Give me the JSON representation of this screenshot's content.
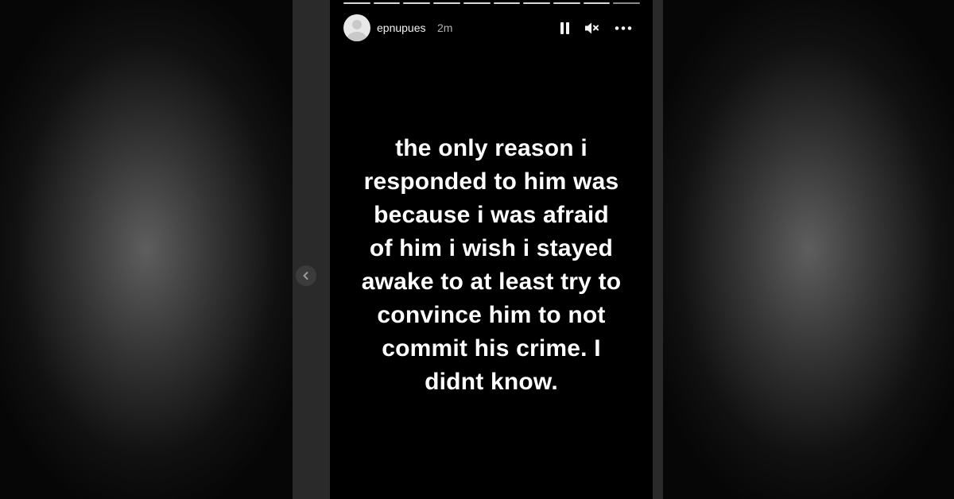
{
  "story": {
    "username": "epnupues",
    "timestamp": "2m",
    "progress_segments": 10,
    "text_lines": [
      "the only reason i",
      "responded to him was",
      "because i was afraid",
      "of him i wish i stayed",
      "awake to at least try to",
      "convince him to not",
      "commit his crime. I",
      "didnt know."
    ]
  },
  "controls": {
    "pause_icon": "pause-icon",
    "mute_icon": "speaker-muted-icon",
    "more_icon": "more-options-icon",
    "prev_icon": "chevron-left-icon"
  },
  "colors": {
    "story_background": "#000000",
    "text": "#ffffff",
    "progress": "#d8d8d8"
  }
}
